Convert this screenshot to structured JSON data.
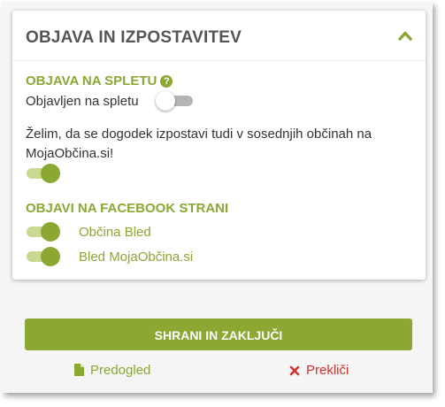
{
  "panel": {
    "title": "OBJAVA IN IZPOSTAVITEV"
  },
  "web_publish": {
    "heading": "OBJAVA NA SPLETU",
    "help_glyph": "?",
    "published_label": "Objavljen na spletu",
    "published_state": "off",
    "neighbor_text_line1": "Želim, da se dogodek izpostavi tudi v sosednjih občinah na",
    "neighbor_text_line2": "MojaObčina.si!",
    "neighbor_state": "on"
  },
  "facebook": {
    "heading": "OBJAVI NA FACEBOOK STRANI",
    "pages": [
      {
        "label": "Občina Bled",
        "state": "on"
      },
      {
        "label": "Bled MojaObčina.si",
        "state": "on"
      }
    ]
  },
  "actions": {
    "save_label": "SHRANI IN ZAKLJUČI",
    "preview_label": "Predogled",
    "cancel_label": "Prekliči"
  },
  "colors": {
    "accent": "#8aa832",
    "accent_light": "#c9d98f",
    "cancel": "#d9312b",
    "title": "#555555"
  },
  "icons": {
    "collapse": "chevron-up-icon",
    "help": "help-circle-icon",
    "preview": "document-icon",
    "cancel": "close-icon"
  }
}
